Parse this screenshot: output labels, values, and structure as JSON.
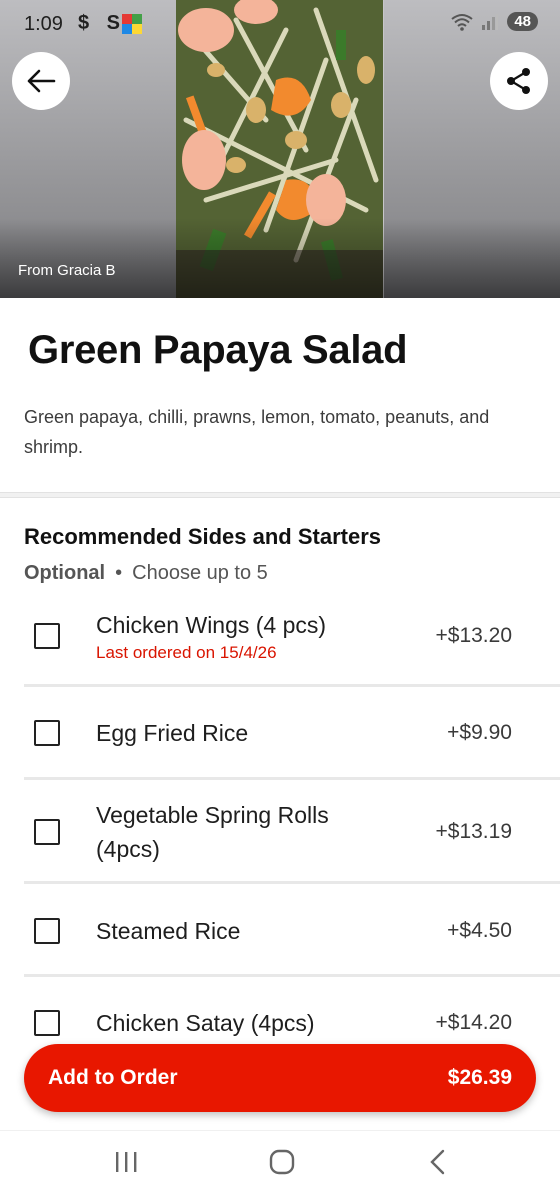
{
  "status_bar": {
    "time": "1:09",
    "app_icons": "$ S",
    "battery": "48"
  },
  "hero": {
    "photo_credit": "From Gracia B"
  },
  "item": {
    "title": "Green Papaya Salad",
    "description": "Green papaya, chilli, prawns, lemon, tomato, peanuts, and shrimp."
  },
  "section": {
    "title": "Recommended Sides and Starters",
    "requirement": "Optional",
    "separator": "•",
    "limit": "Choose up to 5",
    "options": [
      {
        "name": "Chicken Wings (4 pcs)",
        "note": "Last ordered on 15/4/26",
        "price": "+$13.20"
      },
      {
        "name": "Egg Fried Rice",
        "price": "+$9.90"
      },
      {
        "name": "Vegetable Spring Rolls (4pcs)",
        "price": "+$13.19"
      },
      {
        "name": "Steamed Rice",
        "price": "+$4.50"
      },
      {
        "name": "Chicken Satay (4pcs)",
        "price": "+$14.20"
      }
    ]
  },
  "cta": {
    "label": "Add to Order",
    "total": "$26.39"
  },
  "colors": {
    "accent": "#e81700",
    "note_red": "#d91400"
  },
  "icons": [
    "back-arrow-icon",
    "share-icon",
    "wifi-icon",
    "signal-icon",
    "recent-apps-icon",
    "home-icon",
    "nav-back-icon"
  ]
}
